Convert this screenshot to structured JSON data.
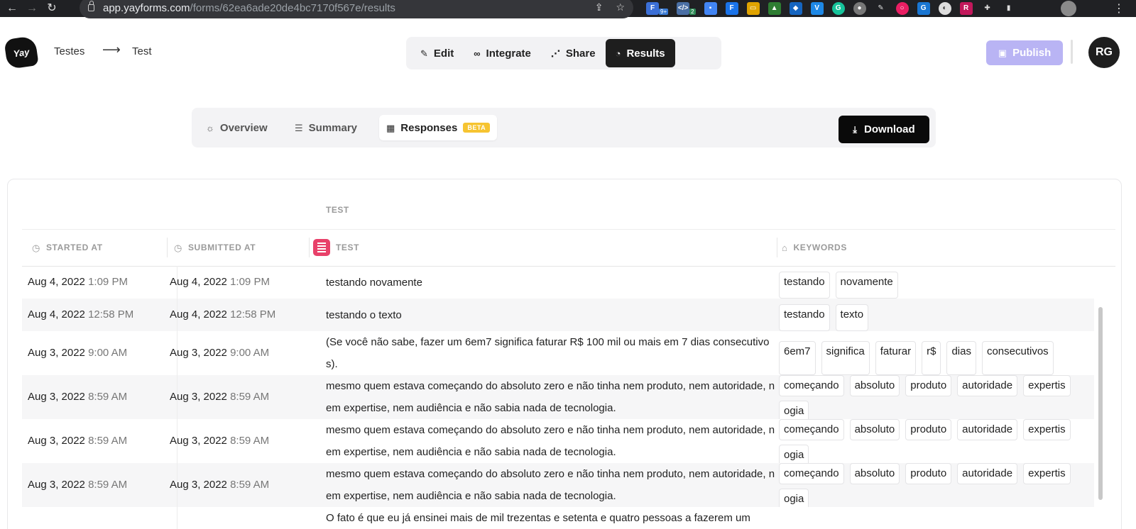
{
  "browser": {
    "url_host": "app.yayforms.com",
    "url_path": "/forms/62ea6ade20de4bc7170f567e/results",
    "ext_badge_1": "9+",
    "ext_badge_2": "2"
  },
  "header": {
    "logo_text": "Yay",
    "breadcrumb_workspace": "Testes",
    "breadcrumb_arrow": "⟶",
    "breadcrumb_form": "Test",
    "nav": {
      "edit": "Edit",
      "integrate": "Integrate",
      "share": "Share",
      "results": "Results"
    },
    "publish_label": "Publish",
    "user_initials": "RG"
  },
  "subnav": {
    "overview": "Overview",
    "summary": "Summary",
    "responses": "Responses",
    "beta": "BETA",
    "download": "Download"
  },
  "table": {
    "group_label": "TEST",
    "columns": {
      "started": "STARTED AT",
      "submitted": "SUBMITTED AT",
      "test": "TEST",
      "keywords": "KEYWORDS"
    },
    "rows": [
      {
        "s_date": "Aug 4, 2022",
        "s_time": "1:09 PM",
        "u_date": "Aug 4, 2022",
        "u_time": "1:09 PM",
        "text": "testando novamente",
        "kw": [
          "testando",
          "novamente"
        ]
      },
      {
        "s_date": "Aug 4, 2022",
        "s_time": "12:58 PM",
        "u_date": "Aug 4, 2022",
        "u_time": "12:58 PM",
        "text": "testando o texto",
        "kw": [
          "testando",
          "texto"
        ]
      },
      {
        "s_date": "Aug 3, 2022",
        "s_time": "9:00 AM",
        "u_date": "Aug 3, 2022",
        "u_time": "9:00 AM",
        "text": "(Se você não sabe, fazer um 6em7 significa faturar R$ 100 mil ou mais em 7 dias consecutivos).",
        "kw": [
          "6em7",
          "significa",
          "faturar",
          "r$",
          "dias",
          "consecutivos"
        ]
      },
      {
        "s_date": "Aug 3, 2022",
        "s_time": "8:59 AM",
        "u_date": "Aug 3, 2022",
        "u_time": "8:59 AM",
        "text": "mesmo quem estava começando do absoluto zero e não tinha nem produto, nem autoridade, nem expertise, nem audiência e não sabia nada de tecnologia.",
        "kw": [
          "começando",
          "absoluto",
          "produto",
          "autoridade",
          "expertis",
          "ogia"
        ]
      },
      {
        "s_date": "Aug 3, 2022",
        "s_time": "8:59 AM",
        "u_date": "Aug 3, 2022",
        "u_time": "8:59 AM",
        "text": "mesmo quem estava começando do absoluto zero e não tinha nem produto, nem autoridade, nem expertise, nem audiência e não sabia nada de tecnologia.",
        "kw": [
          "começando",
          "absoluto",
          "produto",
          "autoridade",
          "expertis",
          "ogia"
        ]
      },
      {
        "s_date": "Aug 3, 2022",
        "s_time": "8:59 AM",
        "u_date": "Aug 3, 2022",
        "u_time": "8:59 AM",
        "text": "mesmo quem estava começando do absoluto zero e não tinha nem produto, nem autoridade, nem expertise, nem audiência e não sabia nada de tecnologia.",
        "kw": [
          "começando",
          "absoluto",
          "produto",
          "autoridade",
          "expertis",
          "ogia"
        ]
      },
      {
        "s_date": "",
        "s_time": "",
        "u_date": "",
        "u_time": "",
        "text": "O fato é que eu já ensinei mais de mil trezentas e setenta e quatro pessoas a fazerem um",
        "kw": []
      }
    ]
  },
  "colors": {
    "accent_dark": "#1e1e1e",
    "publish": "#b9b4f4",
    "beta": "#f6c431",
    "test_icon": "#e8416a"
  }
}
